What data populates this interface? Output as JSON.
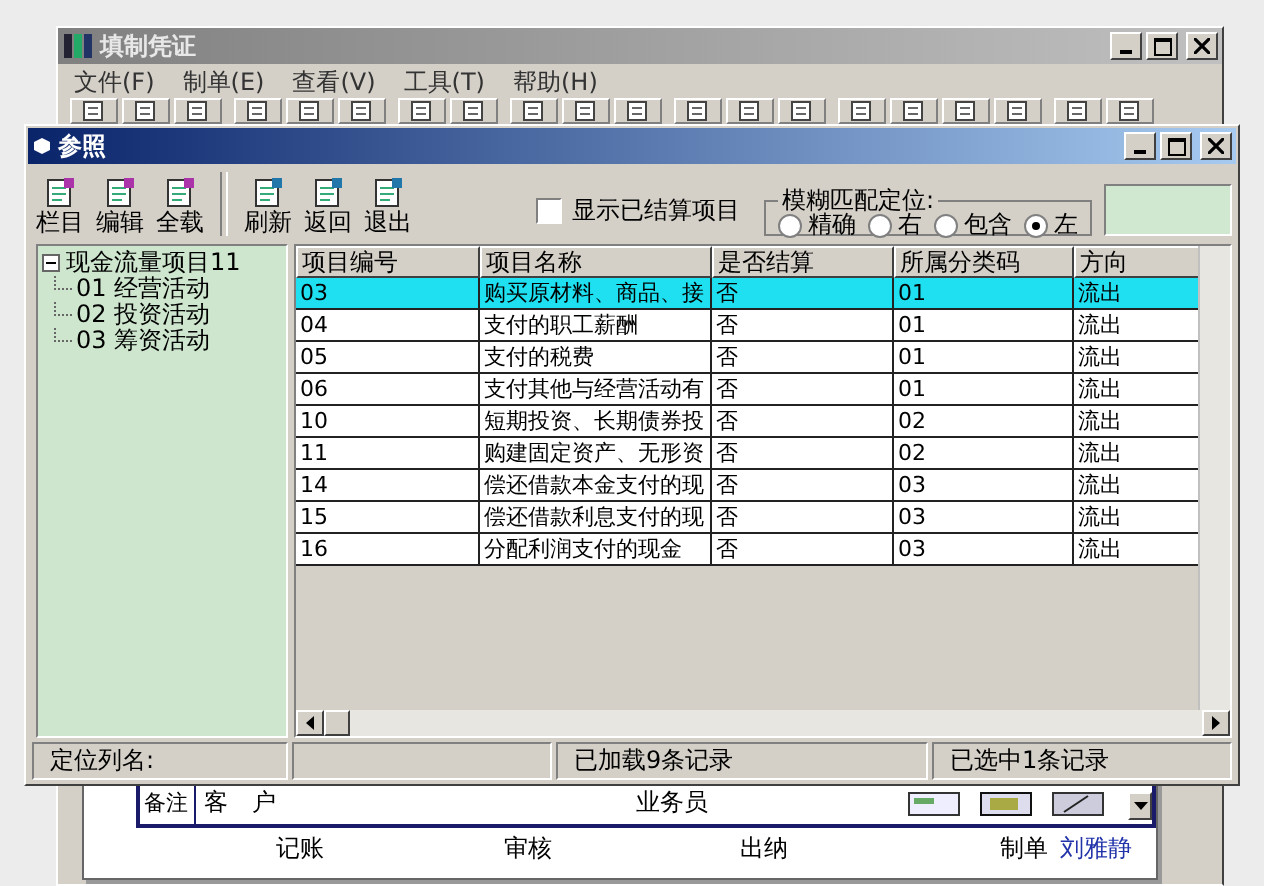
{
  "main_window": {
    "title": "填制凭证",
    "menu": [
      "文件(F)",
      "制单(E)",
      "查看(V)",
      "工具(T)",
      "帮助(H)"
    ],
    "voucher": {
      "remark_label": "备注",
      "customer_label": "客　户",
      "salesperson_label": "业务员",
      "signatures": [
        {
          "label": "记账"
        },
        {
          "label": "审核"
        },
        {
          "label": "出纳"
        },
        {
          "label": "制单",
          "value": "刘雅静"
        }
      ]
    }
  },
  "dialog": {
    "title": "参照",
    "toolbar": [
      {
        "label": "栏目"
      },
      {
        "label": "编辑"
      },
      {
        "label": "全载"
      },
      {
        "label": "刷新"
      },
      {
        "label": "返回"
      },
      {
        "label": "退出"
      }
    ],
    "show_settled": {
      "label": "显示已结算项目",
      "checked": false
    },
    "fuzzy_match": {
      "label": "模糊匹配定位:",
      "options": [
        {
          "label": "精确",
          "selected": false
        },
        {
          "label": "右",
          "selected": false
        },
        {
          "label": "包含",
          "selected": false
        },
        {
          "label": "左",
          "selected": true
        }
      ]
    },
    "tree": {
      "label": "现金流量项目11",
      "expanded": true,
      "children": [
        {
          "label": "01 经营活动"
        },
        {
          "label": "02 投资活动"
        },
        {
          "label": "03 筹资活动"
        }
      ]
    },
    "table": {
      "columns": [
        "项目编号",
        "项目名称",
        "是否结算",
        "所属分类码",
        "方向"
      ],
      "rows": [
        {
          "cells": [
            "03",
            "购买原材料、商品、接",
            "否",
            "01",
            "流出"
          ],
          "selected": true
        },
        {
          "cells": [
            "04",
            "支付的职工薪酬",
            "否",
            "01",
            "流出"
          ],
          "selected": false
        },
        {
          "cells": [
            "05",
            "支付的税费",
            "否",
            "01",
            "流出"
          ],
          "selected": false
        },
        {
          "cells": [
            "06",
            "支付其他与经营活动有",
            "否",
            "01",
            "流出"
          ],
          "selected": false
        },
        {
          "cells": [
            "10",
            "短期投资、长期债券投",
            "否",
            "02",
            "流出"
          ],
          "selected": false
        },
        {
          "cells": [
            "11",
            "购建固定资产、无形资",
            "否",
            "02",
            "流出"
          ],
          "selected": false
        },
        {
          "cells": [
            "14",
            "偿还借款本金支付的现",
            "否",
            "03",
            "流出"
          ],
          "selected": false
        },
        {
          "cells": [
            "15",
            "偿还借款利息支付的现",
            "否",
            "03",
            "流出"
          ],
          "selected": false
        },
        {
          "cells": [
            "16",
            "分配利润支付的现金",
            "否",
            "03",
            "流出"
          ],
          "selected": false
        }
      ]
    },
    "status_bar": {
      "locate_label": "定位列名:",
      "loaded": "已加载9条记录",
      "selected_count": "已选中1条记录"
    }
  }
}
